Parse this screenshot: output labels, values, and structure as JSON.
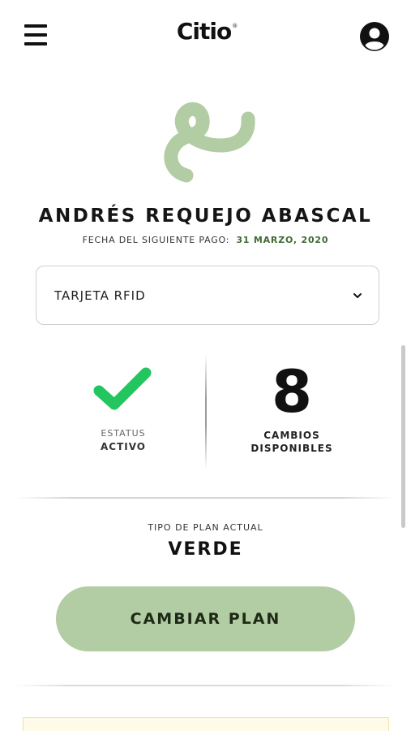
{
  "header": {
    "brand": "Citio",
    "brand_mark": "®",
    "menu_icon": "hamburger-menu-icon",
    "profile_icon": "user-circle-icon"
  },
  "profile": {
    "logo_icon": "citio-swirl-logo-icon",
    "logo_color": "#b2cca4",
    "name": "ANDRÉS REQUEJO ABASCAL",
    "next_payment_label": "FECHA DEL SIGUIENTE PAGO:",
    "next_payment_date": "31 MARZO, 2020"
  },
  "card_select": {
    "selected": "TARJETA RFID",
    "chevron_icon": "chevron-down-icon"
  },
  "status": {
    "icon": "check-icon",
    "icon_color": "#22c55e",
    "label": "ESTATUS",
    "value": "ACTIVO"
  },
  "changes": {
    "count": "8",
    "label_line1": "CAMBIOS",
    "label_line2": "DISPONIBLES"
  },
  "plan": {
    "label": "TIPO DE PLAN ACTUAL",
    "value": "VERDE",
    "button_label": "CAMBIAR PLAN",
    "button_color": "#b2cca4"
  }
}
